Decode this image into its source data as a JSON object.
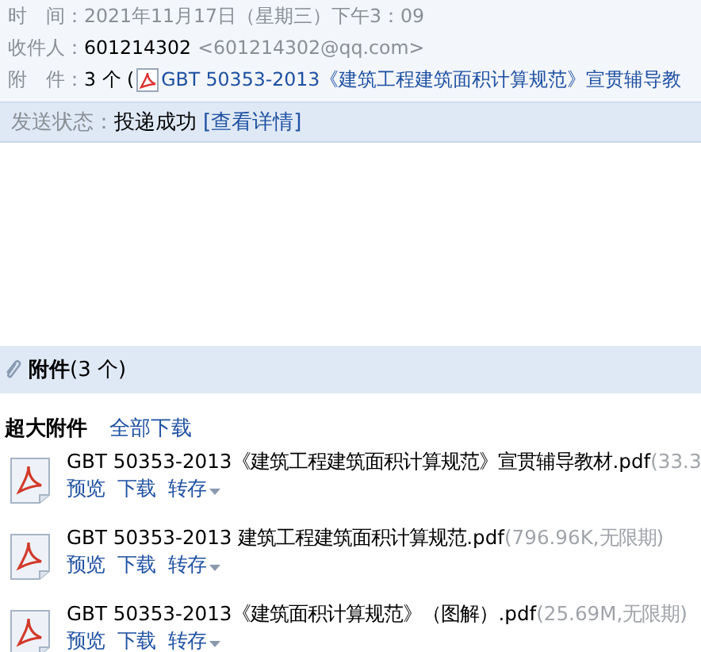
{
  "header": {
    "fields": [
      {
        "kind": "plain",
        "label": "时　间：",
        "value": "2021年11月17日（星期三）下午3：09"
      },
      {
        "kind": "recipient",
        "label": "收件人：",
        "value": "601214302",
        "address": "<601214302@qq.com>"
      },
      {
        "kind": "attachment",
        "label": "附　件：",
        "value": "3 个 (",
        "link": "GBT 50353-2013《建筑工程建筑面积计算规范》宣贯辅导教"
      }
    ]
  },
  "send_status": {
    "label": "发送状态：",
    "value": "投递成功",
    "link": "[查看详情]"
  },
  "attachments": {
    "title": "附件",
    "count": "(3 个)",
    "group": "超大附件",
    "download_all": "全部下载",
    "items": [
      {
        "name": "GBT 50353-2013《建筑工程建筑面积计算规范》宣贯辅导教材.pdf",
        "meta": "(33.3",
        "actions": [
          "预览",
          "下载",
          "转存"
        ]
      },
      {
        "name": "GBT 50353-2013 建筑工程建筑面积计算规范.pdf",
        "meta": "(796.96K,无限期)",
        "actions": [
          "预览",
          "下载",
          "转存"
        ]
      },
      {
        "name": "GBT 50353-2013《建筑面积计算规范》（图解）.pdf",
        "meta": "(25.69M,无限期)",
        "actions": [
          "预览",
          "下载",
          "转存"
        ]
      }
    ]
  }
}
